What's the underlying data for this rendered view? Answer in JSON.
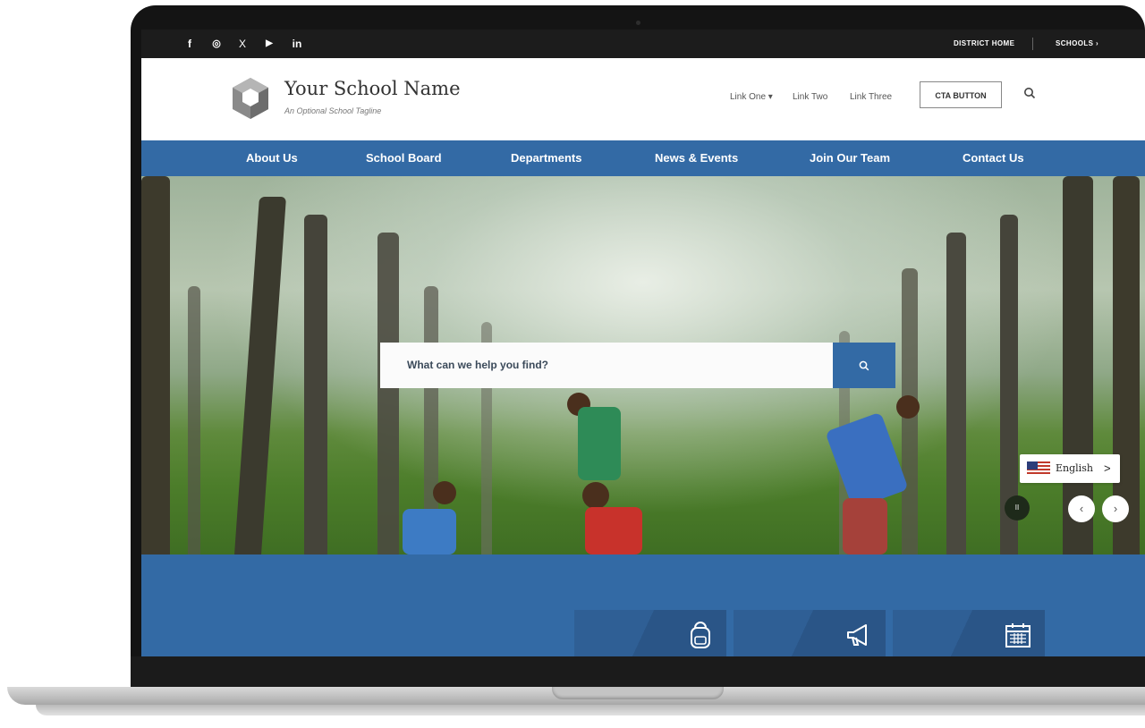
{
  "topbar": {
    "social": [
      {
        "icon": "facebook-icon",
        "glyph": "f"
      },
      {
        "icon": "instagram-icon",
        "glyph": "◎"
      },
      {
        "icon": "x-icon",
        "glyph": "X"
      },
      {
        "icon": "youtube-icon",
        "glyph": "▶"
      },
      {
        "icon": "linkedin-icon",
        "glyph": "in"
      }
    ],
    "district_home": "DISTRICT HOME",
    "schools": "SCHOOLS ›"
  },
  "header": {
    "school_name": "Your School Name",
    "tagline": "An Optional School Tagline",
    "links": [
      "Link One ▾",
      "Link Two",
      "Link Three"
    ],
    "cta": "CTA BUTTON",
    "search_icon": "search-icon"
  },
  "nav": {
    "items": [
      "About Us",
      "School Board",
      "Departments",
      "News & Events",
      "Join Our Team",
      "Contact Us"
    ]
  },
  "hero": {
    "search_placeholder": "What can we help you find?",
    "language": "English",
    "language_chevron": ">",
    "pause_glyph": "II",
    "prev_glyph": "‹",
    "next_glyph": "›"
  },
  "quicklinks": {
    "icons": [
      "backpack-icon",
      "megaphone-icon",
      "calendar-icon"
    ]
  },
  "colors": {
    "brand_blue": "#336aa5",
    "topbar": "#1c1c1c"
  }
}
